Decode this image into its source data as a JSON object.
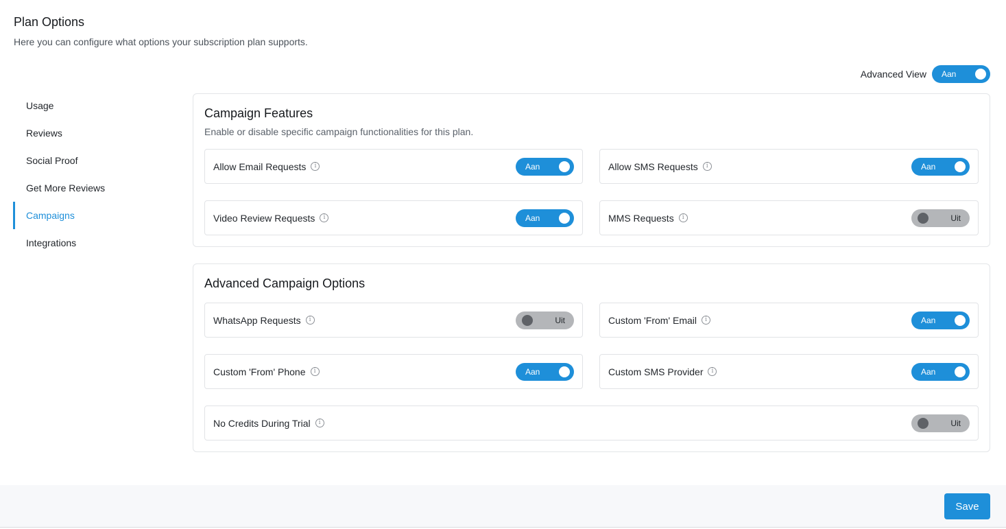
{
  "header": {
    "title": "Plan Options",
    "subtitle": "Here you can configure what options your subscription plan supports."
  },
  "advanced_view": {
    "label": "Advanced View",
    "state": "Aan",
    "on": true
  },
  "sidebar": {
    "items": [
      {
        "label": "Usage",
        "active": false
      },
      {
        "label": "Reviews",
        "active": false
      },
      {
        "label": "Social Proof",
        "active": false
      },
      {
        "label": "Get More Reviews",
        "active": false
      },
      {
        "label": "Campaigns",
        "active": true
      },
      {
        "label": "Integrations",
        "active": false
      }
    ]
  },
  "campaign_features": {
    "title": "Campaign Features",
    "description": "Enable or disable specific campaign functionalities for this plan.",
    "options": [
      {
        "label": "Allow Email Requests",
        "state": "Aan",
        "on": true
      },
      {
        "label": "Allow SMS Requests",
        "state": "Aan",
        "on": true
      },
      {
        "label": "Video Review Requests",
        "state": "Aan",
        "on": true
      },
      {
        "label": "MMS Requests",
        "state": "Uit",
        "on": false
      }
    ]
  },
  "advanced_options": {
    "title": "Advanced Campaign Options",
    "options": [
      {
        "label": "WhatsApp Requests",
        "state": "Uit",
        "on": false
      },
      {
        "label": "Custom 'From' Email",
        "state": "Aan",
        "on": true
      },
      {
        "label": "Custom 'From' Phone",
        "state": "Aan",
        "on": true
      },
      {
        "label": "Custom SMS Provider",
        "state": "Aan",
        "on": true
      },
      {
        "label": "No Credits During Trial",
        "state": "Uit",
        "on": false
      }
    ]
  },
  "footer": {
    "save_label": "Save"
  },
  "colors": {
    "accent": "#1e8fd9",
    "toggle_off": "#b4b6b9"
  }
}
